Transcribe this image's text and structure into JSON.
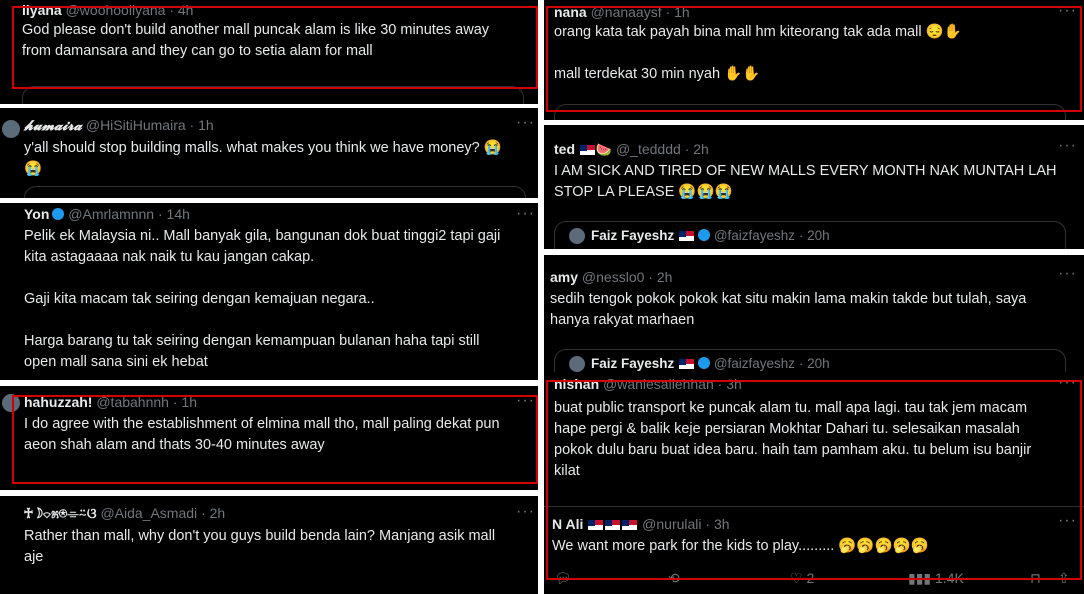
{
  "left": [
    {
      "name": "liyana",
      "handle": "@woohooliyana",
      "time": "4h",
      "text": "God please don't build another mall puncak alam is like 30 minutes away\nfrom damansara and they can go to setia alam for mall"
    },
    {
      "name": "𝓱𝓾𝓶𝓪𝓲𝓻𝓪",
      "handle": "@HiSitiHumaira",
      "time": "1h",
      "text": "y'all should stop building malls. what makes you think we have money? 😭\n😭"
    },
    {
      "name": "Yon",
      "handle": "@Amrlamnnn",
      "time": "14h",
      "text": "Pelik ek Malaysia ni.. Mall banyak gila, bangunan dok buat tinggi2 tapi gaji\nkita astagaaaa nak naik tu kau jangan cakap.\n\nGaji kita macam tak seiring dengan kemajuan negara..\n\nHarga barang tu tak seiring dengan kemampuan bulanan haha tapi still\nopen mall sana sini ek hebat"
    },
    {
      "name": "hahuzzah!",
      "handle": "@tabahnnh",
      "time": "1h",
      "text": "I do agree with the establishment of elmina mall tho, mall paling dekat pun\naeon shah alam and thats 30-40 minutes away"
    },
    {
      "name": "♰☽⌔೫⍟⌯⍨ଓ",
      "handle": "@Aida_Asmadi",
      "time": "2h",
      "text": "Rather than mall, why don't you guys build benda lain? Manjang asik mall\naje"
    }
  ],
  "right": [
    {
      "name": "nana",
      "handle": "@nanaaysf",
      "time": "1h",
      "text": "orang kata tak payah bina mall hm kiteorang tak ada mall 😔✋\n\nmall terdekat 30 min nyah ✋✋"
    },
    {
      "name": "ted",
      "handle": "@_tedddd",
      "time": "2h",
      "text": "I AM SICK AND TIRED OF NEW MALLS EVERY MONTH NAK MUNTAH LAH\nSTOP LA PLEASE 😭😭😭"
    },
    {
      "name": "amy",
      "handle": "@nesslo0",
      "time": "2h",
      "text": "sedih tengok pokok pokok kat situ makin lama makin takde but tulah, saya\nhanya rakyat marhaen"
    },
    {
      "name": "nishan",
      "handle": "@waniesallehhan",
      "time": "3h",
      "text": "buat public transport ke puncak alam tu. mall apa lagi. tau tak jem macam\nhape pergi & balik keje persiaran Mokhtar Dahari tu. selesaikan masalah\npokok dulu baru buat idea baru. haih tam pamham aku. tu belum isu banjir\nkilat"
    },
    {
      "name": "N Ali",
      "handle": "@nurulali",
      "time": "3h",
      "text": "We want more park for the kids to play......... 🥱🥱🥱🥱🥱"
    }
  ],
  "quotes": {
    "faiz_name": "Faiz Fayeshz",
    "faiz_handle": "@faizfayeshz",
    "faiz_time_1": "20h",
    "faiz_time_2": "20h"
  },
  "actions": {
    "likes": "2",
    "views": "1.4K"
  },
  "colors": {
    "tile_bg": "#000000",
    "highlight": "#d40000",
    "text": "#e7e9ea",
    "muted": "#71767b",
    "verified": "#1d9bf0"
  }
}
